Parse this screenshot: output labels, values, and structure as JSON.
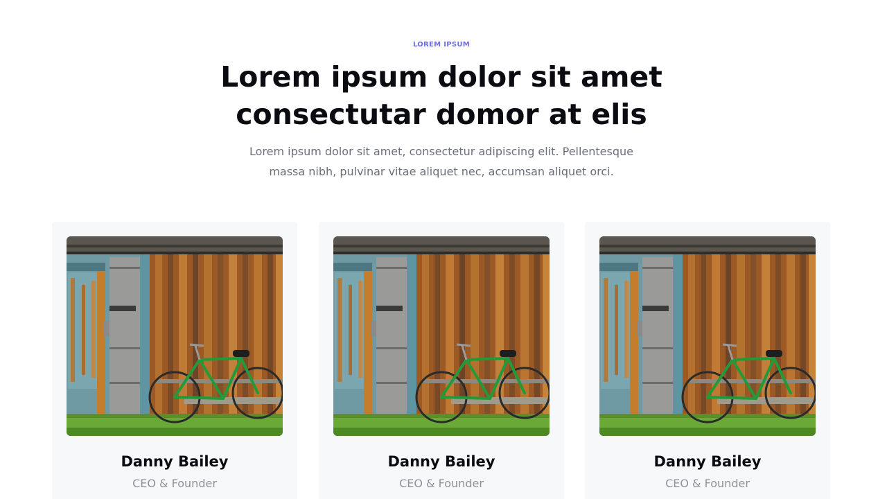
{
  "header": {
    "eyebrow": "LOREM IPSUM",
    "headline_line1": "Lorem ipsum dolor sit amet",
    "headline_line2": "consectutar domor at elis",
    "lead_line1": "Lorem ipsum dolor sit amet, consectetur adipiscing elit. Pellentesque",
    "lead_line2": "massa nibh, pulvinar vitae aliquet nec, accumsan aliquet orci.",
    "eyebrow_color": "#6a6ee0"
  },
  "team": [
    {
      "name": "Danny Bailey",
      "role": "CEO & Founder",
      "photo": "bicycle-against-wooden-barn"
    },
    {
      "name": "Danny Bailey",
      "role": "CEO & Founder",
      "photo": "bicycle-against-wooden-barn"
    },
    {
      "name": "Danny Bailey",
      "role": "CEO & Founder",
      "photo": "bicycle-against-wooden-barn"
    }
  ]
}
